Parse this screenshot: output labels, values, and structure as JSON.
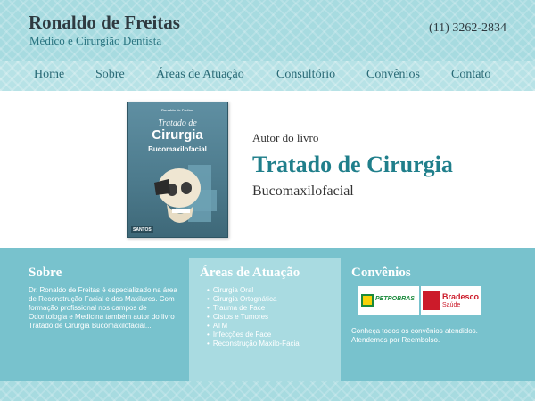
{
  "header": {
    "title": "Ronaldo de Freitas",
    "subtitle": "Médico e Cirurgião Dentista",
    "phone": "(11) 3262-2834"
  },
  "nav": {
    "items": [
      "Home",
      "Sobre",
      "Áreas de Atuação",
      "Consultório",
      "Convênios",
      "Contato"
    ]
  },
  "hero": {
    "kicker": "Autor do livro",
    "title": "Tratado de Cirurgia",
    "subtitle": "Bucomaxilofacial",
    "book": {
      "author": "Ronaldo de Freitas",
      "line1": "Tratado de",
      "line2": "Cirurgia",
      "line3": "Bucomaxilofacial",
      "publisher": "SANTOS"
    }
  },
  "sobre": {
    "heading": "Sobre",
    "text": "Dr. Ronaldo de Freitas é especializado na área de Reconstrução Facial e dos Maxilares. Com formação profissional nos campos de Odontologia e Medicina também autor do livro Tratado de Cirurgia Bucomaxilofacial..."
  },
  "areas": {
    "heading": "Áreas de Atuação",
    "items": [
      "Cirurgia Oral",
      "Cirurgia Ortognática",
      "Trauma de Face",
      "Cistos e Tumores",
      "ATM",
      "Infecções de Face",
      "Reconstrução Maxilo-Facial"
    ]
  },
  "convenios": {
    "heading": "Convênios",
    "logos": {
      "petrobras": "PETROBRAS",
      "petrobras_mark": "BR",
      "bradesco": "Bradesco",
      "bradesco_sub": "Saúde"
    },
    "text": "Conheça todos os convênios atendidos. Atendemos por Reembolso."
  },
  "colors": {
    "accent": "#207f8b",
    "band": "#78c2cd",
    "background": "#a7dbe0"
  }
}
